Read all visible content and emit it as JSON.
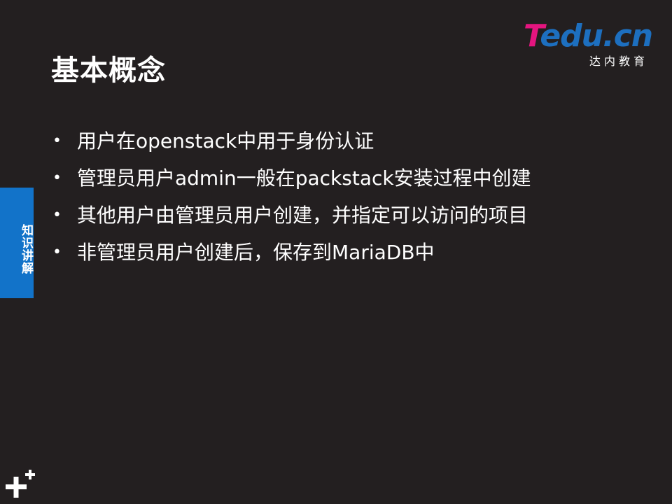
{
  "slide": {
    "title": "基本概念",
    "side_tab_label": "知识讲解",
    "logo": {
      "mark_t": "T",
      "mark_rest": "edu.cn",
      "subtitle": "达内教育"
    },
    "bullets": [
      "用户在openstack中用于身份认证",
      "管理员用户admin一般在packstack安装过程中创建",
      "其他用户由管理员用户创建，并指定可以访问的项目",
      "非管理员用户创建后，保存到MariaDB中"
    ],
    "bullet_marker": "•"
  },
  "colors": {
    "background": "#231f20",
    "text": "#ffffff",
    "side_tab": "#1273c9",
    "logo_pink": "#e4157f",
    "logo_blue": "#1d6fbf"
  },
  "icons": {
    "bottom_left": "plus-icon"
  }
}
